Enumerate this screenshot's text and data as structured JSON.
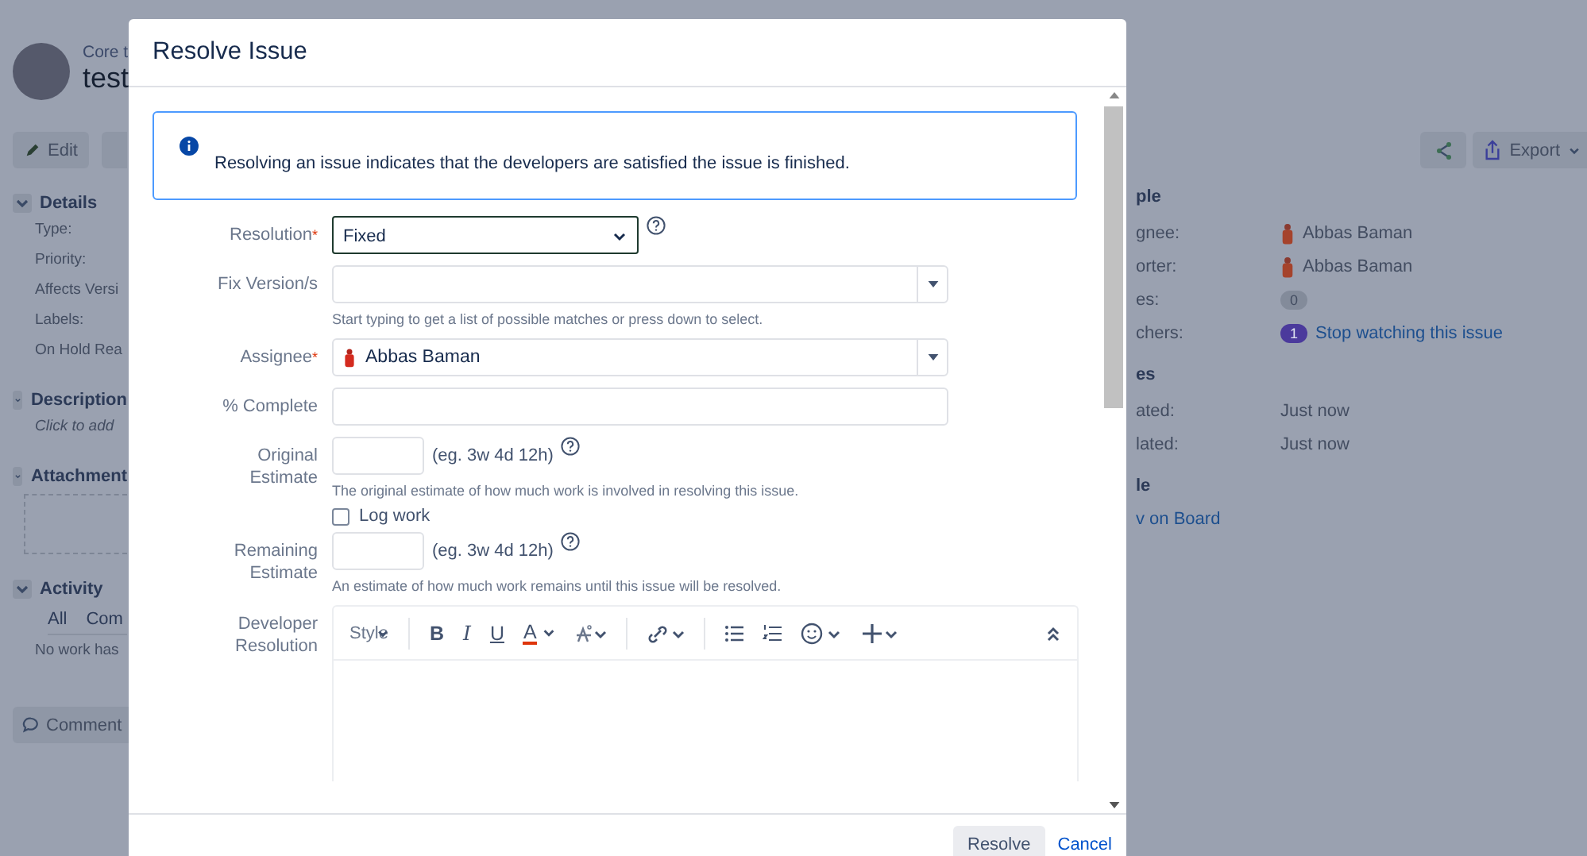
{
  "background_page": {
    "header": {
      "breadcrumb": "Core t",
      "title": "test"
    },
    "edit_button": "Edit",
    "sections": [
      {
        "title": "Details",
        "expanded": true,
        "kind": "fields",
        "items": [
          "Type:",
          "Priority:",
          "Affects Versi",
          "Labels:",
          "On Hold Rea"
        ]
      },
      {
        "title": "Description",
        "expanded": true,
        "kind": "placeholder",
        "items": [
          "Click to add"
        ]
      },
      {
        "title": "Attachment",
        "expanded": true,
        "kind": "dropzone"
      },
      {
        "title": "Activity",
        "expanded": true,
        "kind": "tabs",
        "tabs": [
          {
            "label": "All",
            "selected": false
          },
          {
            "label": "Com",
            "selected": false
          }
        ],
        "items": [
          "No work has"
        ]
      }
    ],
    "comment_button": "Comment",
    "export_button": "Export",
    "people": {
      "title": "ple",
      "rows": [
        {
          "kind": "user",
          "label": "gnee:",
          "value": "Abbas Baman"
        },
        {
          "kind": "user",
          "label": "orter:",
          "value": "Abbas Baman"
        },
        {
          "kind": "count",
          "label": "es:",
          "count": "0"
        },
        {
          "kind": "watch",
          "label": "chers:",
          "count": "1",
          "value": "Stop watching this issue"
        }
      ]
    },
    "dates": {
      "title": "es",
      "rows": [
        {
          "label": "ated:",
          "value": "Just now"
        },
        {
          "label": "lated:",
          "value": "Just now"
        }
      ]
    },
    "agile": {
      "title": "le",
      "link": "v on Board"
    }
  },
  "dialog": {
    "title": "Resolve Issue",
    "required_marker": "*",
    "info": "Resolving an issue indicates that the developers are satisfied the issue is finished.",
    "fields": [
      {
        "kind": "select",
        "label": "Resolution",
        "required": true,
        "value": "Fixed",
        "help": true
      },
      {
        "kind": "picker",
        "label": "Fix Version/s",
        "required": false,
        "hint": "Start typing to get a list of possible matches or press down to select."
      },
      {
        "kind": "user_picker",
        "label": "Assignee",
        "required": true,
        "value": "Abbas Baman"
      },
      {
        "kind": "text",
        "label": "% Complete",
        "required": false
      },
      {
        "kind": "estimate",
        "label": "Original Estimate",
        "required": false,
        "suffix": "(eg. 3w 4d 12h)",
        "help": true,
        "hint": "The original estimate of how much work is involved in resolving this issue."
      },
      {
        "kind": "checkbox",
        "label": "Log work",
        "checked": false
      },
      {
        "kind": "estimate",
        "label": "Remaining Estimate",
        "required": false,
        "suffix": "(eg. 3w 4d 12h)",
        "help": true,
        "hint": "An estimate of how much work remains until this issue will be resolved."
      },
      {
        "kind": "editor",
        "label": "Developer Resolution",
        "required": false,
        "style_menu": "Style",
        "format_buttons": [
          {
            "kind": "bold",
            "label": "B"
          },
          {
            "kind": "italic",
            "label": "I"
          },
          {
            "kind": "underline",
            "label": "U"
          },
          {
            "kind": "color",
            "label": "A"
          }
        ]
      }
    ],
    "buttons": {
      "primary": "Resolve",
      "cancel": "Cancel"
    }
  }
}
